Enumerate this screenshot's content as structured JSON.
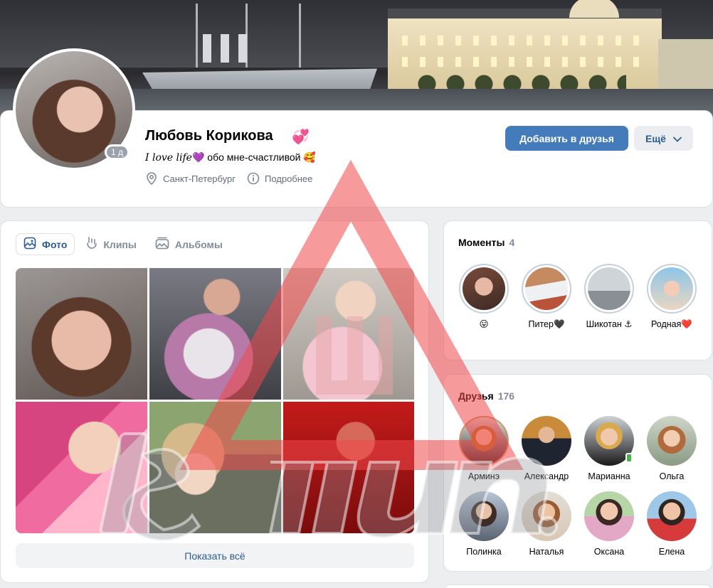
{
  "profile": {
    "name": "Любовь Корикова",
    "name_badge": "💞",
    "online": "1 д",
    "status_script": "I love life",
    "status_heart": "💜",
    "status_text": " обо мне-счастливой ",
    "status_emoji": "🥰",
    "city": "Санкт-Петербург",
    "details": "Подробнее"
  },
  "actions": {
    "add_friend": "Добавить в друзья",
    "more": "Ещё"
  },
  "photos": {
    "tabs": [
      {
        "label": "Фото",
        "icon": "photo-icon",
        "active": true
      },
      {
        "label": "Клипы",
        "icon": "clips-icon",
        "active": false
      },
      {
        "label": "Альбомы",
        "icon": "albums-icon",
        "active": false
      }
    ],
    "show_all": "Показать всё"
  },
  "moments": {
    "title": "Моменты",
    "count": "4",
    "items": [
      {
        "label": "😛"
      },
      {
        "label": "Питер🖤"
      },
      {
        "label": "Шикотан ⚓"
      },
      {
        "label": "Родная❤️"
      }
    ]
  },
  "friends": {
    "title": "Друзья",
    "count": "176",
    "items": [
      {
        "name": "Арминэ",
        "online": false
      },
      {
        "name": "Александр",
        "online": false
      },
      {
        "name": "Марианна",
        "online": true
      },
      {
        "name": "Ольга",
        "online": false
      },
      {
        "name": "Полинка",
        "online": false
      },
      {
        "name": "Наталья",
        "online": false
      },
      {
        "name": "Оксана",
        "online": false
      },
      {
        "name": "Елена",
        "online": false
      }
    ]
  },
  "colors": {
    "accent": "#447bba",
    "link": "#2c5d8f",
    "muted": "#818c99",
    "online": "#4bb34b"
  }
}
